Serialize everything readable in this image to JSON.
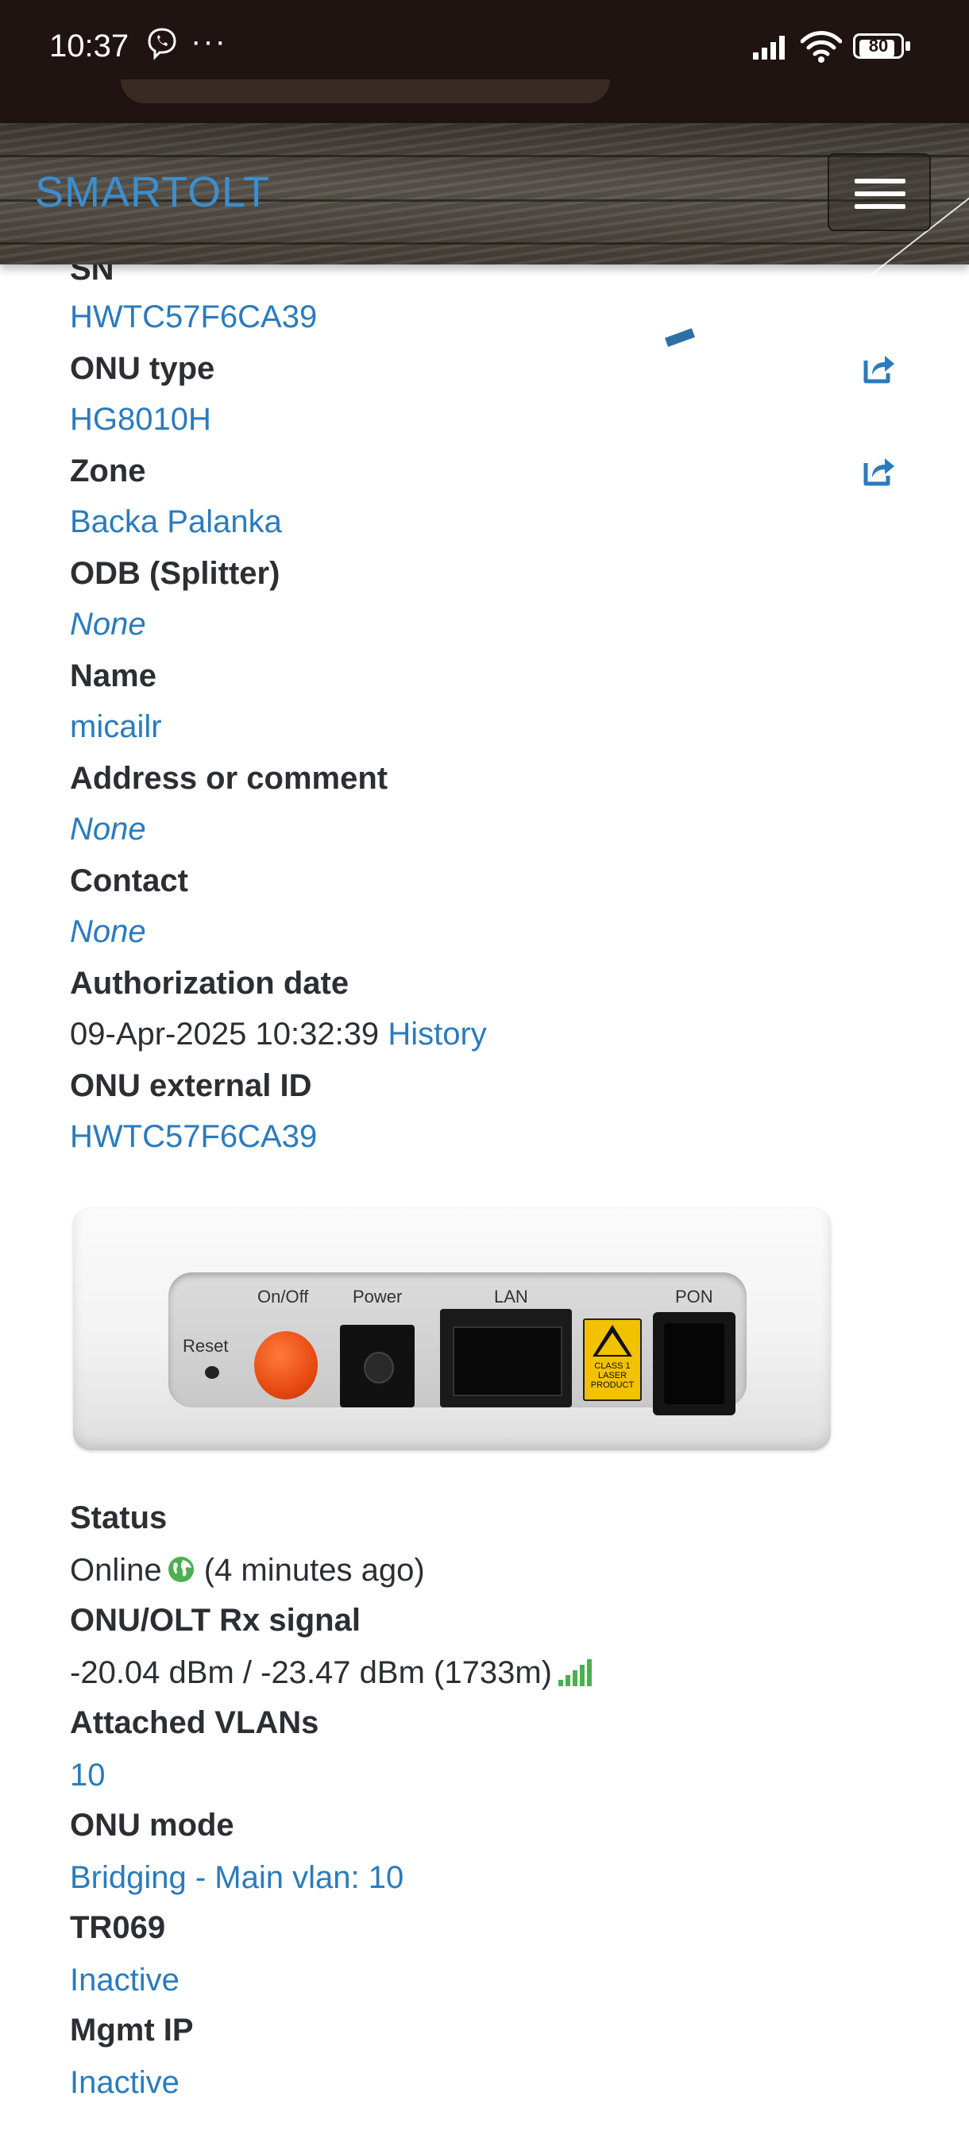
{
  "status_bar": {
    "time": "10:37",
    "dots": "···",
    "battery": "80"
  },
  "navbar": {
    "brand": "SMARTOLT"
  },
  "details": {
    "sn_label": "SN",
    "sn_value": "HWTC57F6CA39",
    "onu_type_label": "ONU type",
    "onu_type_value": "HG8010H",
    "zone_label": "Zone",
    "zone_value": "Backa Palanka",
    "odb_label": "ODB (Splitter)",
    "odb_value": "None",
    "name_label": "Name",
    "name_value": "micailr",
    "address_label": "Address or comment",
    "address_value": "None",
    "contact_label": "Contact",
    "contact_value": "None",
    "auth_date_label": "Authorization date",
    "auth_date_value": "09-Apr-2025 10:32:39",
    "history_link": "History",
    "external_id_label": "ONU external ID",
    "external_id_value": "HWTC57F6CA39"
  },
  "device_image": {
    "reset": "Reset",
    "onoff": "On/Off",
    "power": "Power",
    "lan": "LAN",
    "pon": "PON",
    "laser": "CLASS 1 LASER PRODUCT"
  },
  "status": {
    "status_label": "Status",
    "status_value": "Online",
    "status_ago": "(4 minutes ago)",
    "signal_label": "ONU/OLT Rx signal",
    "signal_value": "-20.04 dBm / -23.47 dBm (1733m)",
    "vlans_label": "Attached VLANs",
    "vlans_value": "10",
    "mode_label": "ONU mode",
    "mode_value": "Bridging - Main vlan: 10",
    "tr069_label": "TR069",
    "tr069_value": "Inactive",
    "mgmt_label": "Mgmt IP",
    "mgmt_value": "Inactive"
  },
  "colors": {
    "link": "#2a7bbd",
    "online_green": "#4caf50"
  }
}
